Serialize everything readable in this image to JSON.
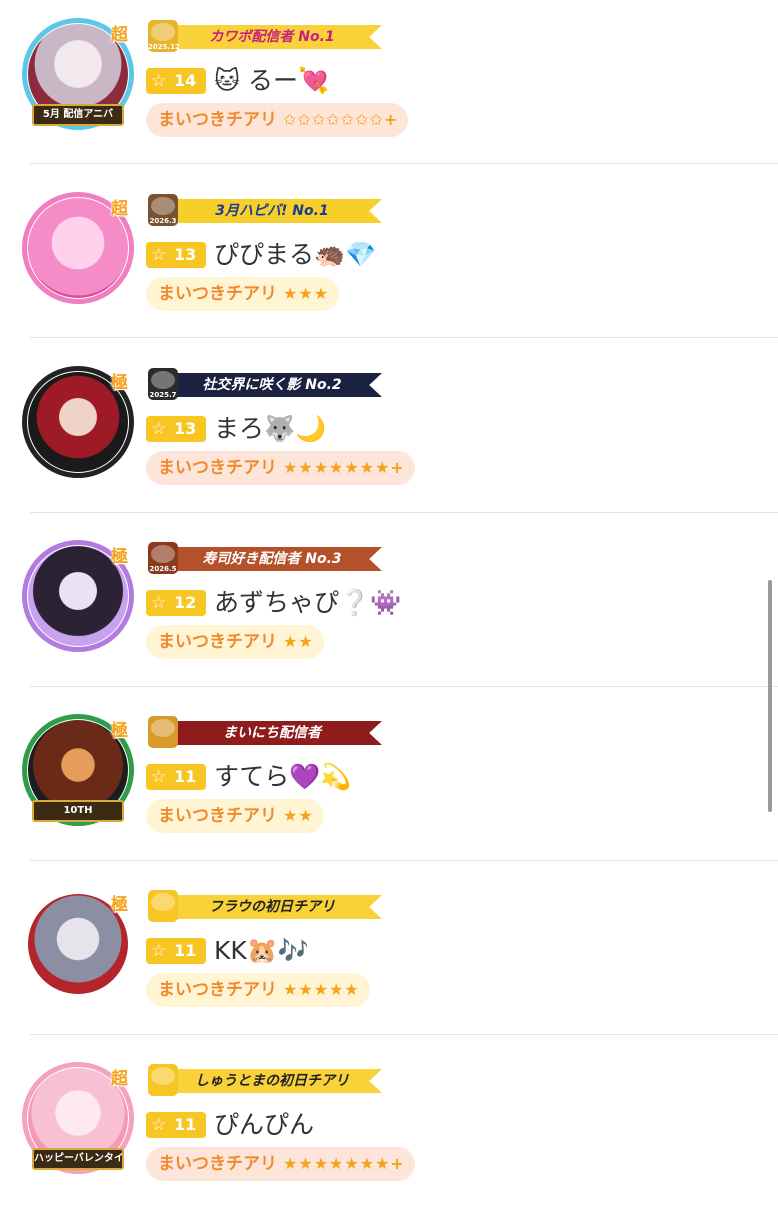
{
  "entries": [
    {
      "avatar_caption": "5月 配信アニバ",
      "rank_mark": "超",
      "banner_text": "カワボ配信者 No.1",
      "banner_date": "2025.12",
      "banner_icon": "gold-medal-icon",
      "level": "14",
      "username": "🐱 るー💘",
      "cheer_label": "まいつきチアリ",
      "cheer_stars": "✩✩✩✩✩✩✩+",
      "cheer_style": "orange",
      "colors": {
        "banner": "#f9d23a",
        "banner_text": "#c9207f",
        "badge": "#e8b42d",
        "ring": "#5cc7e8"
      }
    },
    {
      "avatar_caption": "",
      "rank_mark": "超",
      "banner_text": "3月ハピバ! No.1",
      "banner_date": "2026.3",
      "banner_icon": "cake-icon",
      "level": "13",
      "username": "ぴぴまる🦔💎",
      "cheer_label": "まいつきチアリ",
      "cheer_stars": "★★★",
      "cheer_style": "yellow",
      "colors": {
        "banner": "#f7cf2b",
        "banner_text": "#1e3c8f",
        "badge": "#7a5230",
        "ring": "#f07ec1"
      }
    },
    {
      "avatar_caption": "",
      "rank_mark": "極",
      "banner_text": "社交界に咲く影 No.2",
      "banner_date": "2025.7",
      "banner_icon": "wheat-medal-icon",
      "level": "13",
      "username": "まろ🐺🌙",
      "cheer_label": "まいつきチアリ",
      "cheer_stars": "★★★★★★★+",
      "cheer_style": "orange",
      "colors": {
        "banner": "#1b2140",
        "banner_text": "#ffffff",
        "badge": "#2b2b2b",
        "ring": "#222222"
      }
    },
    {
      "avatar_caption": "",
      "rank_mark": "極",
      "banner_text": "寿司好き配信者 No.3",
      "banner_date": "2026.5",
      "banner_icon": "sushi-icon",
      "level": "12",
      "username": "あずちゃぴ❔👾",
      "cheer_label": "まいつきチアリ",
      "cheer_stars": "★★",
      "cheer_style": "yellow",
      "colors": {
        "banner": "#b5512a",
        "banner_text": "#ffffff",
        "badge": "#8a3b1e",
        "ring": "#b37be0"
      }
    },
    {
      "avatar_caption": "10TH",
      "rank_mark": "極",
      "banner_text": "まいにち配信者",
      "banner_date": "",
      "banner_icon": "kiwami-icon",
      "level": "11",
      "username": "すてら💜💫",
      "cheer_label": "まいつきチアリ",
      "cheer_stars": "★★",
      "cheer_style": "yellow",
      "colors": {
        "banner": "#8e1c1c",
        "banner_text": "#ffffff",
        "badge": "#d89a2a",
        "ring": "#2f9c4a"
      }
    },
    {
      "avatar_caption": "",
      "rank_mark": "極",
      "banner_text": "フラウの初日チアリ",
      "banner_date": "",
      "banner_icon": "star-badge-icon",
      "level": "11",
      "username": "KK🐹🎶",
      "cheer_label": "まいつきチアリ",
      "cheer_stars": "★★★★★",
      "cheer_style": "yellow",
      "colors": {
        "banner": "#f9d23a",
        "banner_text": "#222222",
        "badge": "#f7c623",
        "ring": "#ffffff"
      }
    },
    {
      "avatar_caption": "ハッピーバレンタイン",
      "rank_mark": "超",
      "banner_text": "しゅうとまの初日チアリ",
      "banner_date": "",
      "banner_icon": "star-badge-icon",
      "level": "11",
      "username": "ぴんぴん",
      "cheer_label": "まいつきチアリ",
      "cheer_stars": "★★★★★★★+",
      "cheer_style": "orange",
      "colors": {
        "banner": "#f9d23a",
        "banner_text": "#222222",
        "badge": "#f7c623",
        "ring": "#f4a3b8"
      }
    }
  ]
}
